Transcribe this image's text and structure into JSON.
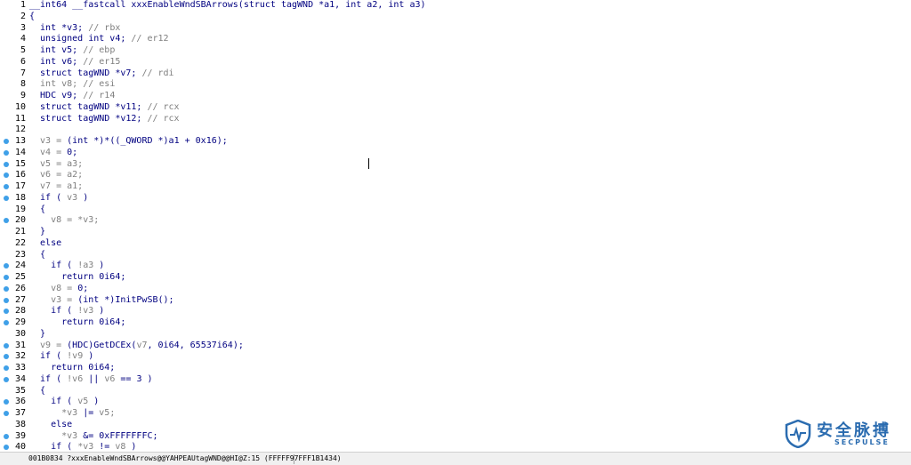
{
  "editor": {
    "lines": [
      {
        "n": "1",
        "bp": false,
        "parts": [
          [
            "kw",
            "__int64 __fastcall xxxEnableWndSBArrows(struct tagWND *a1, int a2, int a3)"
          ]
        ]
      },
      {
        "n": "2",
        "bp": false,
        "parts": [
          [
            "kw",
            "{"
          ]
        ]
      },
      {
        "n": "3",
        "bp": false,
        "parts": [
          [
            "kw",
            "  int *v3; "
          ],
          [
            "cm",
            "// rbx"
          ]
        ]
      },
      {
        "n": "4",
        "bp": false,
        "parts": [
          [
            "kw",
            "  unsigned int v4; "
          ],
          [
            "cm",
            "// er12"
          ]
        ]
      },
      {
        "n": "5",
        "bp": false,
        "parts": [
          [
            "kw",
            "  int v5; "
          ],
          [
            "cm",
            "// ebp"
          ]
        ]
      },
      {
        "n": "6",
        "bp": false,
        "parts": [
          [
            "kw",
            "  int v6; "
          ],
          [
            "cm",
            "// er15"
          ]
        ]
      },
      {
        "n": "7",
        "bp": false,
        "parts": [
          [
            "kw",
            "  struct tagWND *v7; "
          ],
          [
            "cm",
            "// rdi"
          ]
        ]
      },
      {
        "n": "8",
        "bp": false,
        "parts": [
          [
            "vr",
            "  int v8; "
          ],
          [
            "cm",
            "// esi"
          ]
        ]
      },
      {
        "n": "9",
        "bp": false,
        "parts": [
          [
            "kw",
            "  HDC v9; "
          ],
          [
            "cm",
            "// r14"
          ]
        ]
      },
      {
        "n": "10",
        "bp": false,
        "parts": [
          [
            "kw",
            "  struct tagWND *v11; "
          ],
          [
            "cm",
            "// rcx"
          ]
        ]
      },
      {
        "n": "11",
        "bp": false,
        "parts": [
          [
            "kw",
            "  struct tagWND *v12; "
          ],
          [
            "cm",
            "// rcx"
          ]
        ]
      },
      {
        "n": "12",
        "bp": false,
        "parts": [
          [
            "kw",
            ""
          ]
        ]
      },
      {
        "n": "13",
        "bp": true,
        "parts": [
          [
            "vr",
            "  v3 = "
          ],
          [
            "kw",
            "(int *)*((_QWORD *)a1 + 0x16);"
          ]
        ]
      },
      {
        "n": "14",
        "bp": true,
        "parts": [
          [
            "vr",
            "  v4 = "
          ],
          [
            "kw",
            "0;"
          ]
        ]
      },
      {
        "n": "15",
        "bp": true,
        "parts": [
          [
            "vr",
            "  v5 = a3;"
          ]
        ]
      },
      {
        "n": "16",
        "bp": true,
        "parts": [
          [
            "vr",
            "  v6 = a2;"
          ]
        ]
      },
      {
        "n": "17",
        "bp": true,
        "parts": [
          [
            "vr",
            "  v7 = a1;"
          ]
        ]
      },
      {
        "n": "18",
        "bp": true,
        "parts": [
          [
            "kw",
            "  if ( "
          ],
          [
            "vr",
            "v3"
          ],
          [
            "kw",
            " )"
          ]
        ]
      },
      {
        "n": "19",
        "bp": false,
        "parts": [
          [
            "kw",
            "  {"
          ]
        ]
      },
      {
        "n": "20",
        "bp": true,
        "parts": [
          [
            "vr",
            "    v8 = *v3;"
          ]
        ]
      },
      {
        "n": "21",
        "bp": false,
        "parts": [
          [
            "kw",
            "  }"
          ]
        ]
      },
      {
        "n": "22",
        "bp": false,
        "parts": [
          [
            "kw",
            "  else"
          ]
        ]
      },
      {
        "n": "23",
        "bp": false,
        "parts": [
          [
            "kw",
            "  {"
          ]
        ]
      },
      {
        "n": "24",
        "bp": true,
        "parts": [
          [
            "kw",
            "    if ( "
          ],
          [
            "vr",
            "!a3"
          ],
          [
            "kw",
            " )"
          ]
        ]
      },
      {
        "n": "25",
        "bp": true,
        "parts": [
          [
            "kw",
            "      return 0i64;"
          ]
        ]
      },
      {
        "n": "26",
        "bp": true,
        "parts": [
          [
            "vr",
            "    v8 = "
          ],
          [
            "kw",
            "0;"
          ]
        ]
      },
      {
        "n": "27",
        "bp": true,
        "parts": [
          [
            "vr",
            "    v3 = "
          ],
          [
            "kw",
            "(int *)InitPwSB();"
          ]
        ]
      },
      {
        "n": "28",
        "bp": true,
        "parts": [
          [
            "kw",
            "    if ( "
          ],
          [
            "vr",
            "!v3"
          ],
          [
            "kw",
            " )"
          ]
        ]
      },
      {
        "n": "29",
        "bp": true,
        "parts": [
          [
            "kw",
            "      return 0i64;"
          ]
        ]
      },
      {
        "n": "30",
        "bp": false,
        "parts": [
          [
            "kw",
            "  }"
          ]
        ]
      },
      {
        "n": "31",
        "bp": true,
        "parts": [
          [
            "vr",
            "  v9 = "
          ],
          [
            "kw",
            "(HDC)GetDCEx("
          ],
          [
            "vr",
            "v7"
          ],
          [
            "kw",
            ", 0i64, 65537i64);"
          ]
        ]
      },
      {
        "n": "32",
        "bp": true,
        "parts": [
          [
            "kw",
            "  if ( "
          ],
          [
            "vr",
            "!v9"
          ],
          [
            "kw",
            " )"
          ]
        ]
      },
      {
        "n": "33",
        "bp": true,
        "parts": [
          [
            "kw",
            "    return 0i64;"
          ]
        ]
      },
      {
        "n": "34",
        "bp": true,
        "parts": [
          [
            "kw",
            "  if ( "
          ],
          [
            "vr",
            "!v6"
          ],
          [
            "kw",
            " || "
          ],
          [
            "vr",
            "v6"
          ],
          [
            "kw",
            " == 3 )"
          ]
        ]
      },
      {
        "n": "35",
        "bp": false,
        "parts": [
          [
            "kw",
            "  {"
          ]
        ]
      },
      {
        "n": "36",
        "bp": true,
        "parts": [
          [
            "kw",
            "    if ( "
          ],
          [
            "vr",
            "v5"
          ],
          [
            "kw",
            " )"
          ]
        ]
      },
      {
        "n": "37",
        "bp": true,
        "parts": [
          [
            "vr",
            "      *v3 "
          ],
          [
            "kw",
            "|= "
          ],
          [
            "vr",
            "v5;"
          ]
        ]
      },
      {
        "n": "38",
        "bp": false,
        "parts": [
          [
            "kw",
            "    else"
          ]
        ]
      },
      {
        "n": "39",
        "bp": true,
        "parts": [
          [
            "vr",
            "      *v3 "
          ],
          [
            "kw",
            "&= 0xFFFFFFFC;"
          ]
        ]
      },
      {
        "n": "40",
        "bp": true,
        "parts": [
          [
            "kw",
            "    if ( "
          ],
          [
            "vr",
            "*v3"
          ],
          [
            "kw",
            " != "
          ],
          [
            "vr",
            "v8"
          ],
          [
            "kw",
            " )"
          ]
        ]
      }
    ]
  },
  "logo": {
    "cn": "安全脉搏",
    "en": "SECPULSE"
  },
  "status": {
    "text": "001B0834 ?xxxEnableWndSBArrows@@YAHPEAUtagWND@@HI@Z:15 (FFFFF97FFF1B1434)"
  },
  "colors": {
    "breakpoint": "#3fa0e8",
    "code": "#000080",
    "comment": "#7f7f7f",
    "variable": "#808080",
    "brand": "#2b6cb0"
  }
}
